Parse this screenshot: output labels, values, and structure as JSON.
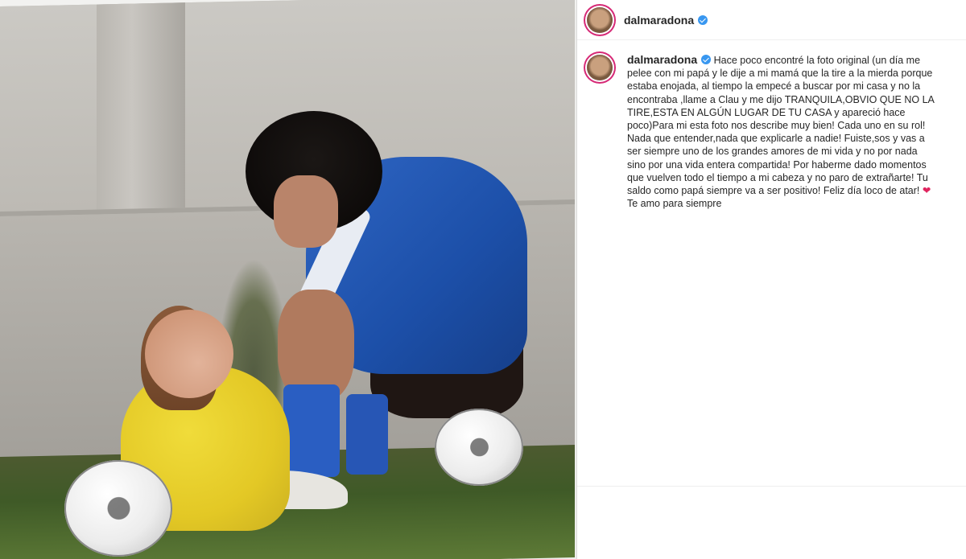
{
  "post": {
    "username": "dalmaradona",
    "caption_text": "Hace poco encontré la foto original (un día me pelee con mi papá y le dije a mi mamá que la tire a la mierda porque estaba enojada, al tiempo la empecé a buscar por mi casa y no la encontraba ,llame a Clau y me dijo TRANQUILA,OBVIO QUE NO LA TIRE,ESTA EN ALGÚN LUGAR DE TU CASA y apareció hace poco)Para mi esta foto nos describe muy bien! Cada uno en su rol! Nada que entender,nada que explicarle a nadie! Fuiste,sos y vas a ser siempre uno de los grandes amores de mi vida y no por nada sino por una vida entera compartida! Por haberme dado momentos que vuelven todo el tiempo a mi cabeza y no paro de extrañarte! Tu saldo como papá siempre va a ser positivo! Feliz día loco de atar!",
    "caption_heart": "❤",
    "caption_end": "Te amo para siempre"
  },
  "icons": {
    "verified": "verified-badge-icon",
    "heart": "heart-emoji-icon"
  },
  "colors": {
    "verified_blue": "#3897f0",
    "story_ring": "#d62976",
    "heart_red": "#e0245e"
  }
}
